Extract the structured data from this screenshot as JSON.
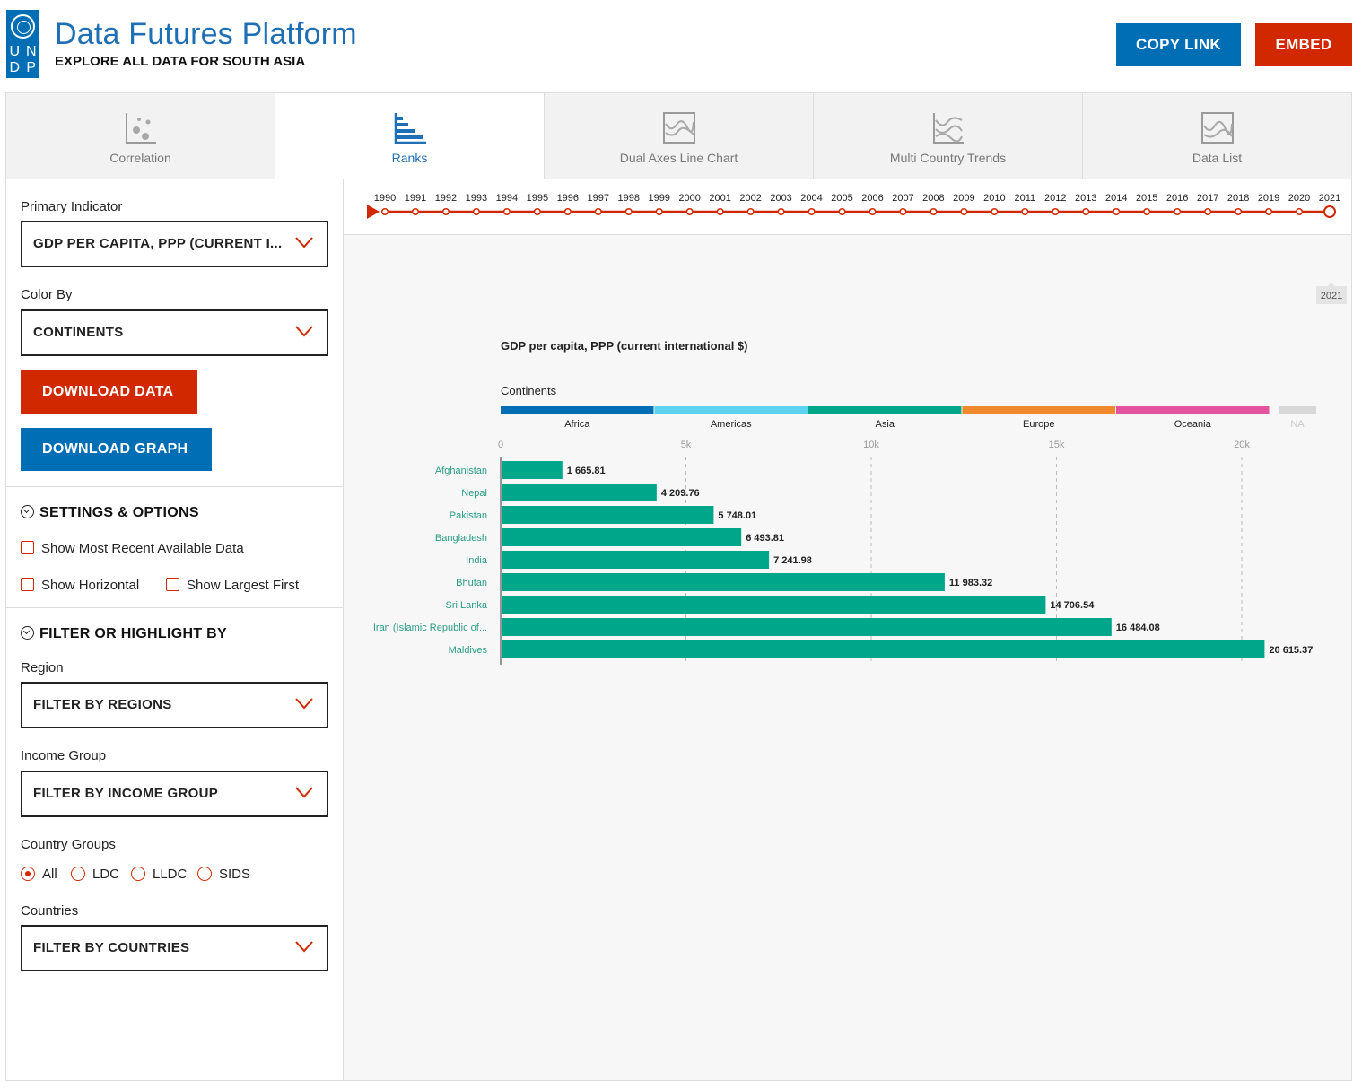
{
  "header": {
    "logo_letters": [
      "U",
      "N",
      "D",
      "P"
    ],
    "title": "Data Futures Platform",
    "subtitle": "EXPLORE ALL DATA FOR SOUTH ASIA",
    "copy_link": "COPY LINK",
    "embed": "EMBED"
  },
  "tabs": [
    {
      "label": "Correlation",
      "icon": "scatter-icon"
    },
    {
      "label": "Ranks",
      "icon": "bar-ranks-icon",
      "active": true
    },
    {
      "label": "Dual Axes Line Chart",
      "icon": "dual-axes-icon"
    },
    {
      "label": "Multi Country Trends",
      "icon": "multi-line-icon"
    },
    {
      "label": "Data List",
      "icon": "data-list-icon"
    }
  ],
  "sidebar": {
    "primary_indicator_label": "Primary Indicator",
    "primary_indicator_value": "GDP PER CAPITA, PPP (CURRENT I...",
    "color_by_label": "Color By",
    "color_by_value": "CONTINENTS",
    "download_data": "DOWNLOAD DATA",
    "download_graph": "DOWNLOAD GRAPH",
    "settings_title": "SETTINGS & OPTIONS",
    "show_recent": "Show Most Recent Available Data",
    "show_horizontal": "Show Horizontal",
    "show_largest": "Show Largest First",
    "filter_title": "FILTER OR HIGHLIGHT BY",
    "region_label": "Region",
    "region_value": "FILTER BY REGIONS",
    "income_label": "Income Group",
    "income_value": "FILTER BY INCOME GROUP",
    "country_groups_label": "Country Groups",
    "country_groups": [
      "All",
      "LDC",
      "LLDC",
      "SIDS"
    ],
    "country_groups_selected": "All",
    "countries_label": "Countries",
    "countries_value": "FILTER BY COUNTRIES"
  },
  "timeline": {
    "years": [
      "1990",
      "1991",
      "1992",
      "1993",
      "1994",
      "1995",
      "1996",
      "1997",
      "1998",
      "1999",
      "2000",
      "2001",
      "2002",
      "2003",
      "2004",
      "2005",
      "2006",
      "2007",
      "2008",
      "2009",
      "2010",
      "2011",
      "2012",
      "2013",
      "2014",
      "2015",
      "2016",
      "2017",
      "2018",
      "2019",
      "2020",
      "2021"
    ],
    "selected": "2021",
    "color": "#d12800"
  },
  "legend": {
    "title": "Continents",
    "items": [
      {
        "name": "Africa",
        "color": "#006eb5"
      },
      {
        "name": "Americas",
        "color": "#5bd3f0"
      },
      {
        "name": "Asia",
        "color": "#00a68a"
      },
      {
        "name": "Europe",
        "color": "#f0892c"
      },
      {
        "name": "Oceania",
        "color": "#e4539d"
      },
      {
        "name": "NA",
        "color": "#d8d8d8"
      }
    ]
  },
  "chart_data": {
    "type": "bar",
    "orientation": "horizontal",
    "title": "GDP per capita, PPP (current international $)",
    "categories": [
      "Afghanistan",
      "Nepal",
      "Pakistan",
      "Bangladesh",
      "India",
      "Bhutan",
      "Sri Lanka",
      "Iran (Islamic Republic of...",
      "Maldives"
    ],
    "values": [
      1665.81,
      4209.76,
      5748.01,
      6493.81,
      7241.98,
      11983.32,
      14706.54,
      16484.08,
      20615.37
    ],
    "value_labels": [
      "1 665.81",
      "4 209.76",
      "5 748.01",
      "6 493.81",
      "7 241.98",
      "11 983.32",
      "14 706.54",
      "16 484.08",
      "20 615.37"
    ],
    "xticks": [
      0,
      5000,
      10000,
      15000,
      20000
    ],
    "xtick_labels": [
      "0",
      "5k",
      "10k",
      "15k",
      "20k"
    ],
    "xlim": [
      0,
      22000
    ],
    "bar_color": "#00a68a",
    "grid": "vertical dashed"
  }
}
